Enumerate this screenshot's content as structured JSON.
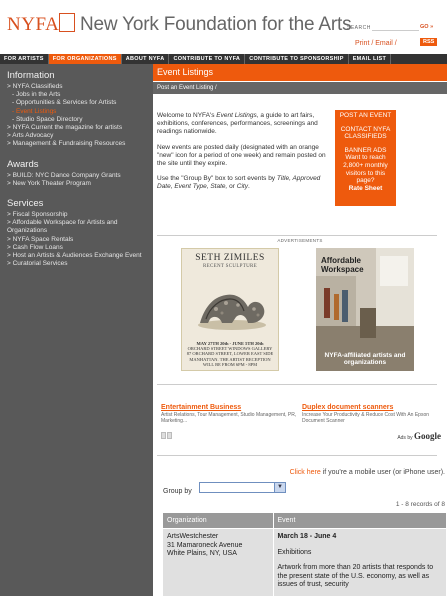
{
  "header": {
    "logo_text": "NYFA",
    "site_name": "New York Foundation for the Arts",
    "search_label": "SEARCH",
    "search_placeholder": "",
    "go_label": "GO »",
    "print_link": "Print",
    "sep": "/",
    "email_link": "Email",
    "rss_label": "RSS"
  },
  "nav": {
    "items": [
      {
        "label": "FOR ARTISTS"
      },
      {
        "label": "FOR ORGANIZATIONS"
      },
      {
        "label": "ABOUT NYFA"
      },
      {
        "label": "CONTRIBUTE TO NYFA"
      },
      {
        "label": "CONTRIBUTE TO SPONSORSHIP"
      },
      {
        "label": "EMAIL LIST"
      }
    ]
  },
  "sidebar": {
    "information_title": "Information",
    "information_items": [
      {
        "label": "> NYFA Classifieds"
      },
      {
        "label": "- Jobs in the Arts"
      },
      {
        "label": "- Opportunities & Services for Artists"
      },
      {
        "label": "- Event Listings"
      },
      {
        "label": "- Studio Space Directory"
      },
      {
        "label": "> NYFA Current the magazine for artists"
      },
      {
        "label": "> Arts Advocacy"
      },
      {
        "label": "> Management & Fundraising Resources"
      }
    ],
    "awards_title": "Awards",
    "awards_items": [
      {
        "label": "> BUILD: NYC Dance Company Grants"
      },
      {
        "label": "> New York Theater Program"
      }
    ],
    "services_title": "Services",
    "services_items": [
      {
        "label": "> Fiscal Sponsorship"
      },
      {
        "label": "> Affordable Workspace for Artists and Organizations"
      },
      {
        "label": "> NYFA Space Rentals"
      },
      {
        "label": "> Cash Flow Loans"
      },
      {
        "label": "> Host an Artists & Audiences Exchange Event"
      },
      {
        "label": "> Curatorial Services"
      }
    ]
  },
  "main": {
    "title": "Event Listings",
    "breadcrumb": "Post an Event Listing /",
    "intro_1a": "Welcome to NYFA's ",
    "intro_1b": "Event Listings",
    "intro_1c": ", a guide to art fairs, exhibitions, conferences, performances, screenings and readings nationwide.",
    "intro_2": "New events are posted daily (designated with an orange \"new\" icon for a period of one week) and remain posted on the site until they expire.",
    "intro_3a": "Use the \"Group By\" box to sort events by ",
    "intro_3b": "Title, Approved Date, Event Type, State,",
    "intro_3c": " or ",
    "intro_3d": "City",
    "intro_3e": ".",
    "promo": {
      "post_event": "POST AN EVENT",
      "contact": "CONTACT NYFA CLASSIFIEDS",
      "banner_ads": "BANNER ADS",
      "banner_text": "Want to reach 2,800+ monthly visitors to this page?",
      "rate_sheet": "Rate Sheet"
    },
    "ads_label": "ADVERTISEMENTS",
    "ad_zimiles": {
      "title": "SETH ZIMILES",
      "subtitle": "RECENT SCULPTURE",
      "line1": "MAY 27TH 20th - JUNE 5TH 20th",
      "line2": "ORCHARD STREET WINDOWS GALLERY",
      "line3": "87 ORCHARD STREET, LOWER EAST SIDE",
      "line4": "MANHATTAN. THE ARTIST RECEPTION",
      "line5": "WILL BE FROM 6PM - 8PM"
    },
    "ad_workspace": {
      "title1": "Affordable",
      "title2": "Workspace",
      "body": "NYFA-affiliated artists and organizations"
    },
    "adsense": {
      "ad1_title": "Entertainment Business",
      "ad1_desc": "Artist Relations, Tour Management, Studio Management, PR, Marketing...",
      "ad2_title": "Duplex document scanners",
      "ad2_desc": "Increase Your Productivity & Reduce Cost With An Epson Document Scanner",
      "ads_by": "Ads by",
      "google": "Google"
    },
    "mobile_link": "Click here",
    "mobile_text": " if you're a mobile user (or iPhone user).",
    "groupby_label": "Group by",
    "groupby_value": "",
    "records": "1 - 8 records of 8",
    "table": {
      "headers": [
        "Organization",
        "Event"
      ],
      "row1": {
        "org_name": "ArtsWestchester",
        "org_addr1": "31 Mamaroneck Avenue",
        "org_addr2": "White Plains, NY, USA",
        "date": "March 18 - June 4",
        "event_title": "Exhibitions",
        "event_desc": "Artwork from more than 20 artists that responds to the present state of the U.S. economy, as well as issues of trust, security"
      }
    }
  }
}
